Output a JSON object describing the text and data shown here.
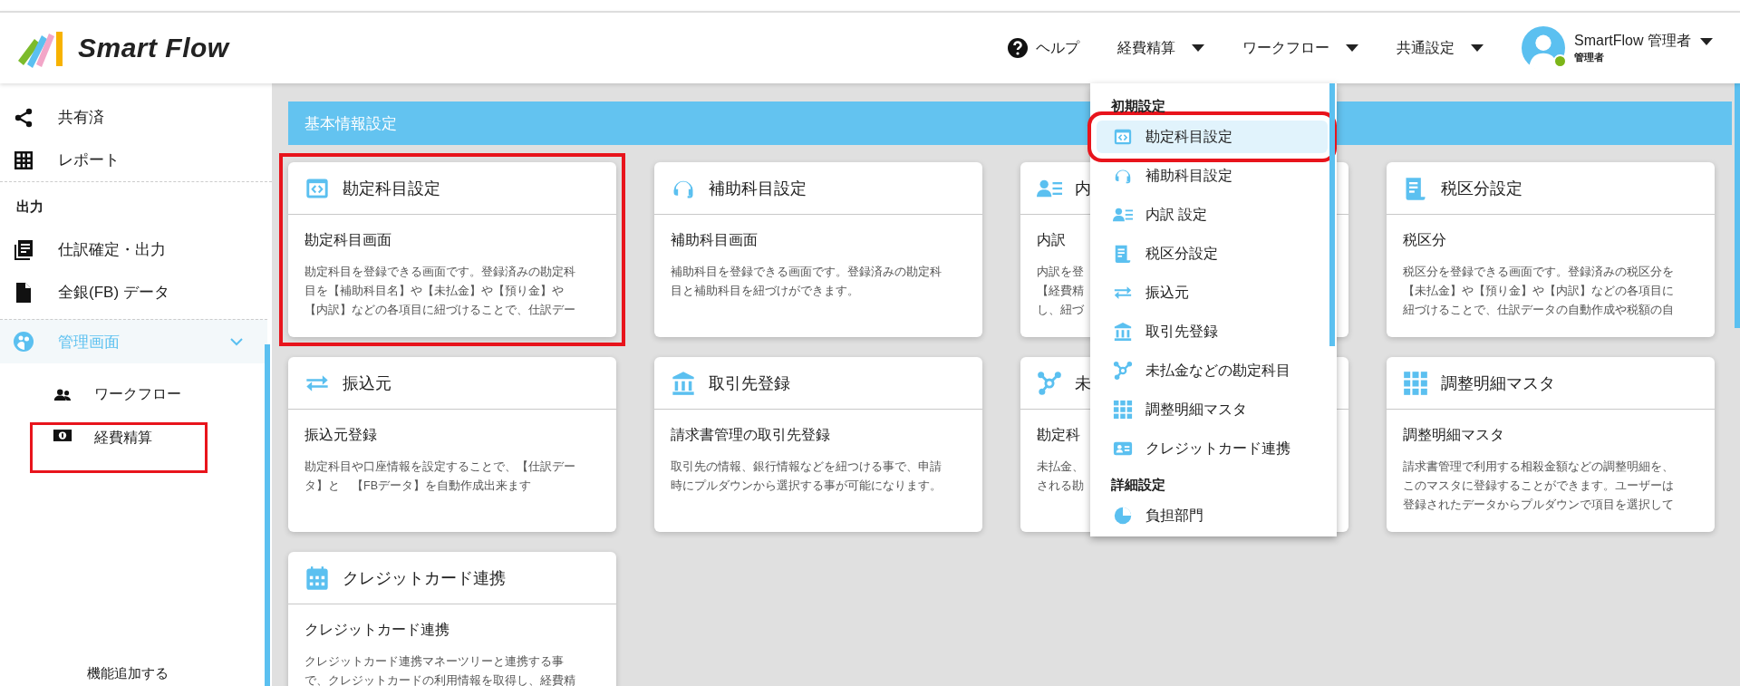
{
  "header": {
    "logo": "Smart Flow",
    "nav": [
      {
        "label": "ヘルプ",
        "kind": "help"
      },
      {
        "label": "経費精算",
        "kind": "dropdown"
      },
      {
        "label": "ワークフロー",
        "kind": "dropdown"
      },
      {
        "label": "共通設定",
        "kind": "dropdown"
      }
    ],
    "user": {
      "name": "SmartFlow 管理者",
      "role": "管理者",
      "online": true
    }
  },
  "sidebar": {
    "items": [
      {
        "kind": "item",
        "label": "共有済",
        "selected": false
      },
      {
        "kind": "item",
        "label": "レポート",
        "selected": false
      },
      {
        "kind": "section",
        "label": "出力"
      },
      {
        "kind": "item",
        "label": "仕訳確定・出力",
        "selected": false
      },
      {
        "kind": "item",
        "label": "全銀(FB) データ",
        "selected": false
      },
      {
        "kind": "group",
        "label": "管理画面",
        "selected": true,
        "expanded": true,
        "children": [
          {
            "label": "ワークフロー",
            "highlighted": false
          },
          {
            "label": "経費精算",
            "highlighted": true
          }
        ]
      }
    ],
    "footer_link": "機能追加する"
  },
  "section_title": "基本情報設定",
  "cards": [
    {
      "title": "勘定科目設定",
      "subtitle": "勘定科目画面",
      "description_lines": [
        "勘定科目を登録できる画面です。登録済みの勘定科",
        "目を【補助科目名】や【未払金】や【預り金】や",
        "【内訳】などの各項目に紐づけることで、仕訳デー"
      ],
      "highlighted": true
    },
    {
      "title": "補助科目設定",
      "subtitle": "補助科目画面",
      "description_lines": [
        "補助科目を登録できる画面です。登録済みの勘定科",
        "目と補助科目を紐づけができます。"
      ],
      "highlighted": false
    },
    {
      "title": "内",
      "subtitle": "内訳",
      "description_lines": [
        "内訳を登",
        "【経費精",
        "し、紐づ"
      ],
      "highlighted": false
    },
    {
      "title": "税区分設定",
      "subtitle": "税区分",
      "description_lines": [
        "税区分を登録できる画面です。登録済みの税区分を",
        "【未払金】や【預り金】や【内訳】などの各項目に",
        "紐づけることで、仕訳データの自動作成や税額の自"
      ],
      "highlighted": false
    },
    {
      "title": "振込元",
      "subtitle": "振込元登録",
      "description_lines": [
        "勘定科目や口座情報を設定することで、【仕訳デー",
        "タ】と　【FBデータ】を自動作成出来ます"
      ],
      "highlighted": false
    },
    {
      "title": "取引先登録",
      "subtitle": "請求書管理の取引先登録",
      "description_lines": [
        "取引先の情報、銀行情報などを紐つける事で、申請",
        "時にプルダウンから選択する事が可能になります。"
      ],
      "highlighted": false
    },
    {
      "title": "未",
      "subtitle": "勘定科",
      "description_lines": [
        "未払金、",
        "される勘"
      ],
      "highlighted": false
    },
    {
      "title": "調整明細マスタ",
      "subtitle": "調整明細マスタ",
      "description_lines": [
        "請求書管理で利用する相殺金額などの調整明細を、",
        "このマスタに登録することができます。ユーザーは",
        "登録されたデータからプルダウンで項目を選択して"
      ],
      "highlighted": false
    },
    {
      "title": "クレジットカード連携",
      "subtitle": "クレジットカード連携",
      "description_lines": [
        "クレジットカード連携マネーツリーと連携する事",
        "で、クレジットカードの利用情報を取得し、経費精"
      ],
      "highlighted": false
    }
  ],
  "dropdown": {
    "groups": [
      {
        "title": "初期設定",
        "items": [
          {
            "label": "勘定科目設定",
            "selected": true,
            "highlighted": true
          },
          {
            "label": "補助科目設定",
            "selected": false,
            "highlighted": false
          },
          {
            "label": "内訳 設定",
            "selected": false,
            "highlighted": false
          },
          {
            "label": "税区分設定",
            "selected": false,
            "highlighted": false
          },
          {
            "label": "振込元",
            "selected": false,
            "highlighted": false
          },
          {
            "label": "取引先登録",
            "selected": false,
            "highlighted": false
          },
          {
            "label": "未払金などの勘定科目",
            "selected": false,
            "highlighted": false
          },
          {
            "label": "調整明細マスタ",
            "selected": false,
            "highlighted": false
          },
          {
            "label": "クレジットカード連携",
            "selected": false,
            "highlighted": false
          }
        ]
      },
      {
        "title": "詳細設定",
        "items": [
          {
            "label": "負担部門",
            "selected": false,
            "highlighted": false
          }
        ]
      }
    ]
  }
}
